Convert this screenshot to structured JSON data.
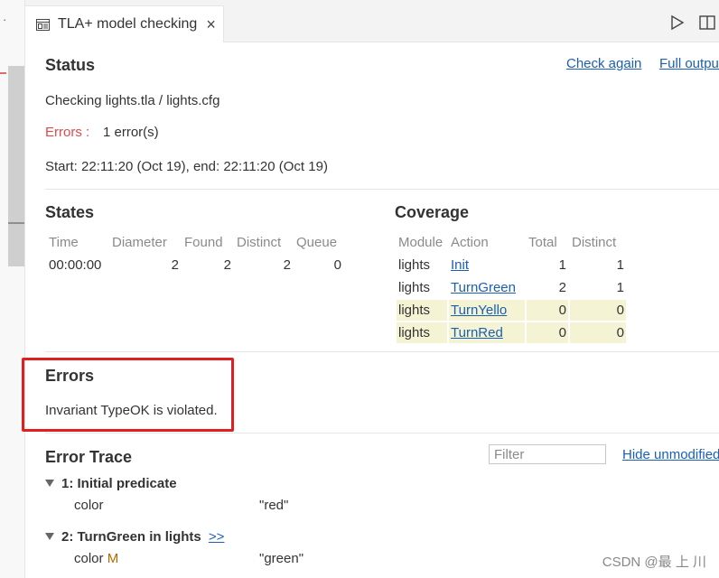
{
  "tab": {
    "title": "TLA+ model checking",
    "close": "×"
  },
  "status": {
    "heading": "Status",
    "check_again": "Check again",
    "full_output": "Full output",
    "checking": "Checking lights.tla / lights.cfg",
    "errors_label": "Errors :",
    "errors_value": "1 error(s)",
    "times": "Start: 22:11:20 (Oct 19), end: 22:11:20 (Oct 19)"
  },
  "states": {
    "heading": "States",
    "columns": [
      "Time",
      "Diameter",
      "Found",
      "Distinct",
      "Queue"
    ],
    "row": [
      "00:00:00",
      "2",
      "2",
      "2",
      "0"
    ]
  },
  "coverage": {
    "heading": "Coverage",
    "columns": [
      "Module",
      "Action",
      "Total",
      "Distinct"
    ],
    "rows": [
      [
        "lights",
        "Init",
        "1",
        "1"
      ],
      [
        "lights",
        "TurnGreen",
        "2",
        "1"
      ],
      [
        "lights",
        "TurnYello",
        "0",
        "0"
      ],
      [
        "lights",
        "TurnRed",
        "0",
        "0"
      ]
    ]
  },
  "errors": {
    "heading": "Errors",
    "message": "Invariant TypeOK is violated."
  },
  "trace": {
    "heading": "Error Trace",
    "filter_placeholder": "Filter",
    "hide_unmodified": "Hide unmodified",
    "steps": [
      {
        "title": "1: Initial predicate",
        "link": "",
        "var": "color",
        "mod": "",
        "value": "\"red\""
      },
      {
        "title": "2: TurnGreen in lights",
        "link": ">>",
        "var": "color",
        "mod": "M",
        "value": "\"green\""
      }
    ]
  },
  "watermark": "CSDN @最 上 川",
  "colors": {
    "link": "#1a5fb4",
    "error": "#e24a4a",
    "highlight_row": "#f4f4d4",
    "annotation_box": "#e02020"
  }
}
